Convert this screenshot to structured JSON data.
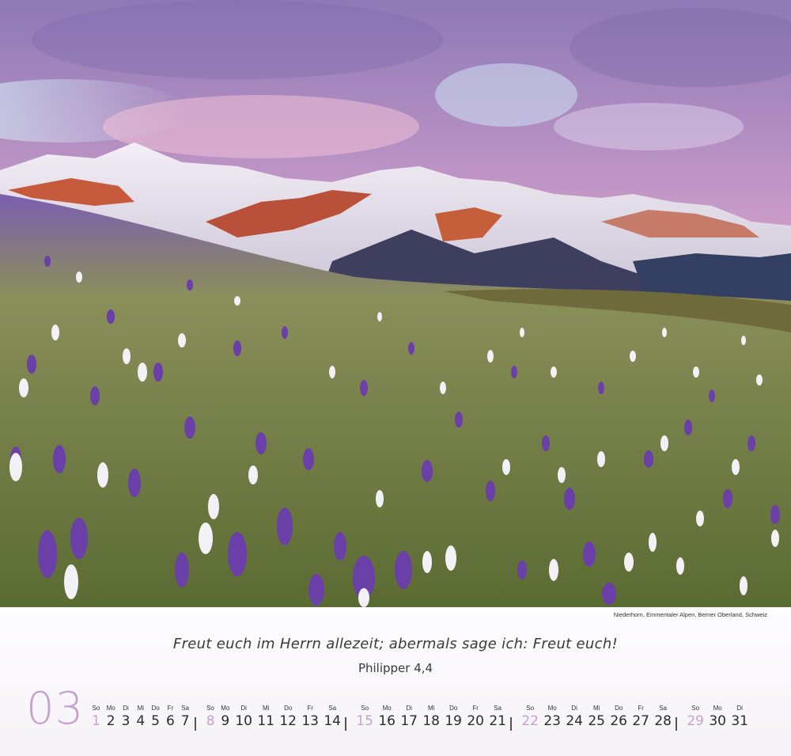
{
  "photo": {
    "caption": "Niederhorn, Emmentaler Alpen, Berner Oberland, Schweiz"
  },
  "quote": {
    "text": "Freut euch im Herrn allezeit; abermals sage ich: Freut euch!",
    "reference": "Philipper 4,4"
  },
  "month": {
    "number": "03"
  },
  "calendar": {
    "weekday_labels": [
      "So",
      "Mo",
      "Di",
      "Mi",
      "Do",
      "Fr",
      "Sa"
    ],
    "first_weekday_index": 0,
    "days_in_month": 31
  },
  "colors": {
    "accent": "#c4a3cc",
    "text": "#3a3a3a"
  }
}
